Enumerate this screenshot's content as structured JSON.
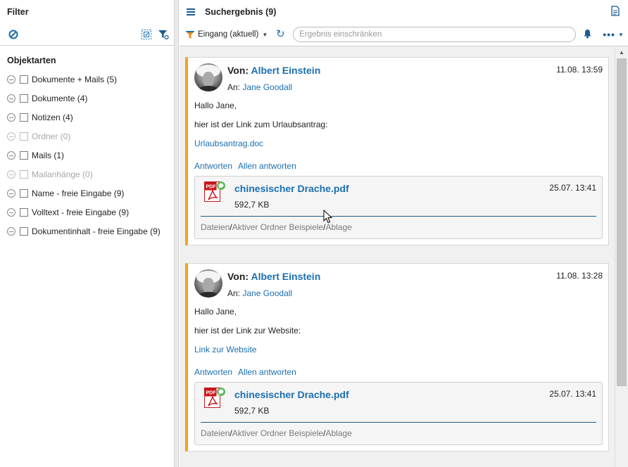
{
  "filter": {
    "title": "Filter",
    "icons": {
      "clear": "no-entry-icon",
      "select_all": "select-all-icon",
      "filter": "funnel-settings-icon"
    },
    "section_title": "Objektarten",
    "items": [
      {
        "label": "Dokumente + Mails (5)",
        "enabled": true
      },
      {
        "label": "Dokumente (4)",
        "enabled": true
      },
      {
        "label": "Notizen (4)",
        "enabled": true
      },
      {
        "label": "Ordner (0)",
        "enabled": false
      },
      {
        "label": "Mails (1)",
        "enabled": true
      },
      {
        "label": "Mailanhänge (0)",
        "enabled": false
      },
      {
        "label": "Name - freie Eingabe (9)",
        "enabled": true
      },
      {
        "label": "Volltext - freie Eingabe (9)",
        "enabled": true
      },
      {
        "label": "Dokumentinhalt - freie Eingabe (9)",
        "enabled": true
      }
    ]
  },
  "results": {
    "title": "Suchergebnis (9)",
    "scope_label": "Eingang (aktuell)",
    "search_placeholder": "Ergebnis einschränken",
    "more_label": "•••",
    "cards": [
      {
        "from_prefix": "Von:",
        "from": "Albert Einstein",
        "to_prefix": "An:",
        "to": "Jane Goodall",
        "date": "11.08. 13:59",
        "greeting": "Hallo Jane,",
        "text": "hier ist der Link zum Urlaubsantrag:",
        "link": "Urlaubsantrag.doc",
        "reply": "Antworten",
        "reply_all": "Allen antworten",
        "attachment": {
          "name": "chinesischer Drache.pdf",
          "size": "592,7 KB",
          "date": "25.07. 13:41",
          "path": [
            "Dateien",
            "Aktiver Ordner Beispiele",
            "Ablage"
          ]
        }
      },
      {
        "from_prefix": "Von:",
        "from": "Albert Einstein",
        "to_prefix": "An:",
        "to": "Jane Goodall",
        "date": "11.08. 13:28",
        "greeting": "Hallo Jane,",
        "text": "hier ist der Link zur Website:",
        "link": "Link zur Website",
        "reply": "Antworten",
        "reply_all": "Allen antworten",
        "attachment": {
          "name": "chinesischer Drache.pdf",
          "size": "592,7 KB",
          "date": "25.07. 13:41",
          "path": [
            "Dateien",
            "Aktiver Ordner Beispiele",
            "Ablage"
          ]
        }
      }
    ]
  },
  "colors": {
    "accent": "#1b6fb1",
    "card_stripe": "#f2a31e",
    "pdf_red": "#c8161d"
  }
}
